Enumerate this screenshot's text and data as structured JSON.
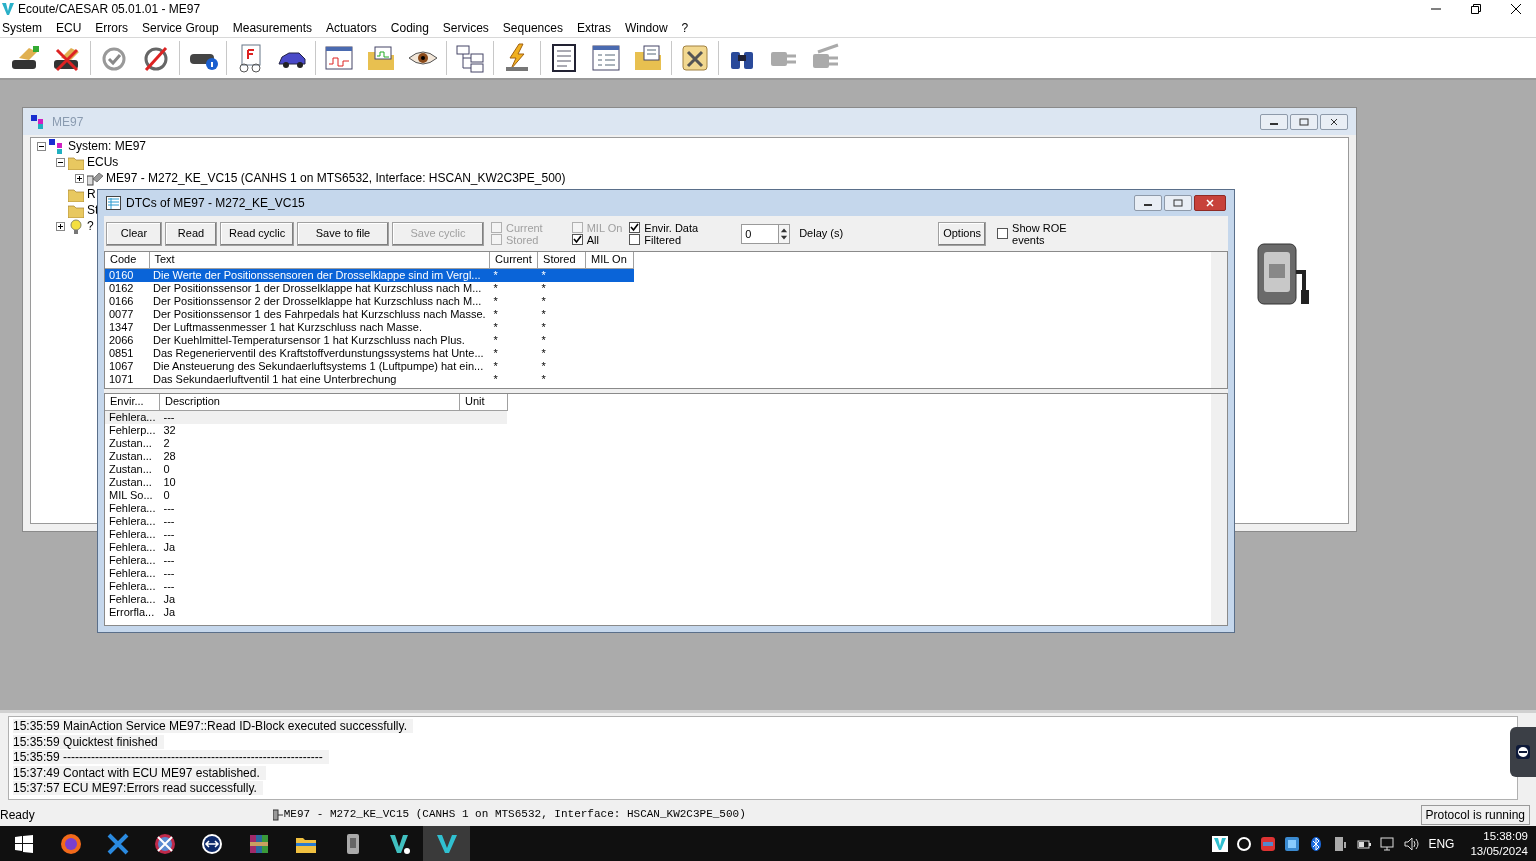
{
  "window": {
    "title": "Ecoute/CAESAR 05.01.01 - ME97"
  },
  "menu": [
    "System",
    "ECU",
    "Errors",
    "Service Group",
    "Measurements",
    "Actuators",
    "Coding",
    "Services",
    "Sequences",
    "Extras",
    "Window",
    "?"
  ],
  "system_window": {
    "title": "ME97",
    "tree": [
      {
        "label": "System: ME97",
        "kind": "system",
        "expanded": true,
        "children": [
          {
            "label": "ECUs",
            "kind": "folder",
            "expanded": true,
            "children": [
              {
                "label": "ME97 - M272_KE_VC15 (CANHS 1 on MTS6532, Interface: HSCAN_KW2C3PE_500)",
                "kind": "ecu",
                "expanded": false
              }
            ]
          },
          {
            "label": "R",
            "kind": "folder"
          },
          {
            "label": "St",
            "kind": "folder"
          },
          {
            "label": "?",
            "kind": "bulb",
            "expanded": false
          }
        ]
      }
    ]
  },
  "dtc_window": {
    "title": "DTCs of ME97 - M272_KE_VC15",
    "buttons": [
      {
        "label": "Clear",
        "disabled": false
      },
      {
        "label": "Read",
        "disabled": false
      },
      {
        "label": "Read cyclic",
        "disabled": false
      },
      {
        "label": "Save to file",
        "disabled": false
      },
      {
        "label": "Save cyclic",
        "disabled": true
      }
    ],
    "filters": [
      {
        "label": "Current",
        "checked": false,
        "disabled": true
      },
      {
        "label": "Stored",
        "checked": false,
        "disabled": true
      },
      {
        "label": "MIL On",
        "checked": false,
        "disabled": true
      },
      {
        "label": "All",
        "checked": true,
        "disabled": false
      },
      {
        "label": "Envir. Data",
        "checked": true,
        "disabled": false
      },
      {
        "label": "Filtered",
        "checked": false,
        "disabled": false
      }
    ],
    "delay": {
      "value": "0",
      "label": "Delay (s)"
    },
    "options_button": "Options",
    "show_roe": {
      "label": "Show ROE events",
      "checked": false
    },
    "dtc_table": {
      "columns": [
        "Code",
        "Text",
        "Current",
        "Stored",
        "MIL On"
      ],
      "rows": [
        {
          "code": "0160",
          "text": "Die Werte der Positionssensoren der Drosselklappe sind im Vergl...",
          "current": "*",
          "stored": "*",
          "selected": true
        },
        {
          "code": "0162",
          "text": "Der Positionssensor 1 der Drosselklappe hat Kurzschluss nach M...",
          "current": "*",
          "stored": "*",
          "selected": false
        },
        {
          "code": "0166",
          "text": "Der Positionssensor 2 der Drosselklappe hat Kurzschluss nach M...",
          "current": "*",
          "stored": "*",
          "selected": false
        },
        {
          "code": "0077",
          "text": "Der Positionssensor 1 des Fahrpedals hat Kurzschluss nach Masse.",
          "current": "*",
          "stored": "*",
          "selected": false
        },
        {
          "code": "1347",
          "text": "Der Luftmassenmesser 1 hat Kurzschluss nach Masse.",
          "current": "*",
          "stored": "*",
          "selected": false
        },
        {
          "code": "2066",
          "text": "Der Kuehlmittel-Temperatursensor 1 hat Kurzschluss nach Plus.",
          "current": "*",
          "stored": "*",
          "selected": false
        },
        {
          "code": "0851",
          "text": "Das Regenerierventil des Kraftstoffverdunstungssystems hat Unte...",
          "current": "*",
          "stored": "*",
          "selected": false
        },
        {
          "code": "1067",
          "text": "Die Ansteuerung des Sekundaerluftsystems 1 (Luftpumpe) hat ein...",
          "current": "*",
          "stored": "*",
          "selected": false
        },
        {
          "code": "1071",
          "text": "Das Sekundaerluftventil 1 hat eine Unterbrechung",
          "current": "*",
          "stored": "*",
          "selected": false
        }
      ]
    },
    "env_table": {
      "columns": [
        "Envir...",
        "Description",
        "Unit"
      ],
      "rows": [
        {
          "name": "Fehlera...",
          "value": "---",
          "selected": true
        },
        {
          "name": "Fehlerp...",
          "value": "32",
          "selected": false
        },
        {
          "name": "Zustan...",
          "value": "2",
          "selected": false
        },
        {
          "name": "Zustan...",
          "value": "28",
          "selected": false
        },
        {
          "name": "Zustan...",
          "value": "0",
          "selected": false
        },
        {
          "name": "Zustan...",
          "value": "10",
          "selected": false
        },
        {
          "name": "MIL So...",
          "value": "0",
          "selected": false
        },
        {
          "name": "Fehlera...",
          "value": "---",
          "selected": false
        },
        {
          "name": "Fehlera...",
          "value": "---",
          "selected": false
        },
        {
          "name": "Fehlera...",
          "value": "---",
          "selected": false
        },
        {
          "name": "Fehlera...",
          "value": "Ja",
          "selected": false
        },
        {
          "name": "Fehlera...",
          "value": "---",
          "selected": false
        },
        {
          "name": "Fehlera...",
          "value": "---",
          "selected": false
        },
        {
          "name": "Fehlera...",
          "value": "---",
          "selected": false
        },
        {
          "name": "Fehlera...",
          "value": "Ja",
          "selected": false
        },
        {
          "name": "Errorfla...",
          "value": "Ja",
          "selected": false
        }
      ]
    }
  },
  "log": [
    "15:35:59 MainAction Service ME97::Read ID-Block executed successfully.",
    "15:35:59 Quicktest finished",
    "15:35:59 -----------------------------------------------------------------",
    "15:37:49 Contact with ECU ME97 established.",
    "15:37:57 ECU ME97:Errors read successfully."
  ],
  "status_bar": {
    "text": "Ready",
    "connection": "ME97 - M272_KE_VC15 (CANHS 1 on MTS6532, Interface: HSCAN_KW2C3PE_500)",
    "protocol": "Protocol is running"
  },
  "taskbar": {
    "apps": [
      {
        "selected": false
      },
      {
        "selected": false
      },
      {
        "selected": false
      },
      {
        "selected": false
      },
      {
        "selected": false
      },
      {
        "selected": false
      },
      {
        "selected": false
      },
      {
        "selected": false
      },
      {
        "selected": true
      }
    ],
    "language": "ENG",
    "time": "15:38:09",
    "date": "13/05/2024"
  }
}
